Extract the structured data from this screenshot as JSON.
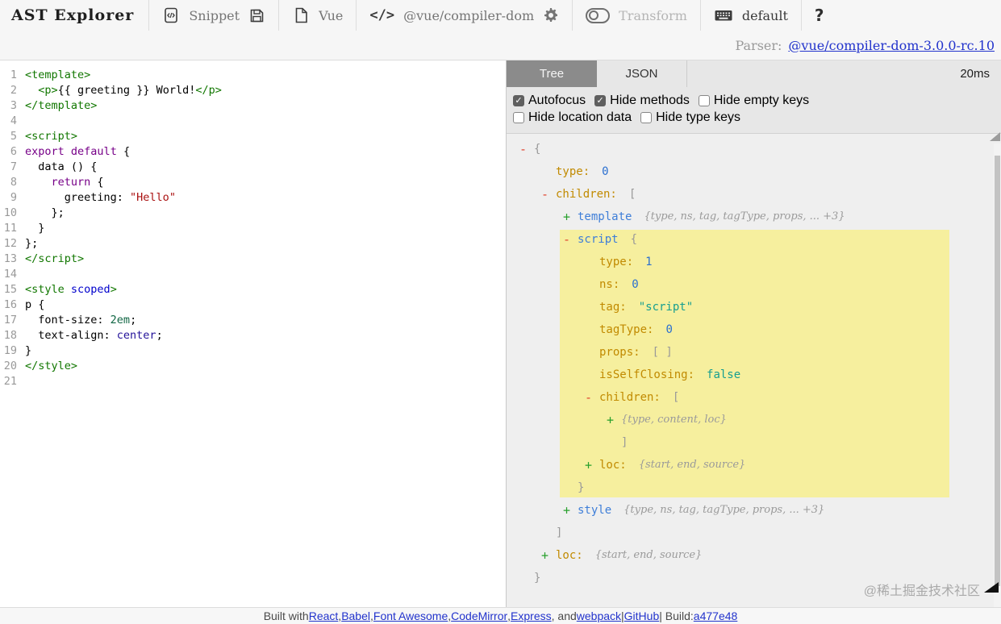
{
  "toolbar": {
    "title": "AST Explorer",
    "snippet_label": "Snippet",
    "language_label": "Vue",
    "code_icon_glyph": "</>",
    "parser_package": "@vue/compiler-dom",
    "transform_label": "Transform",
    "default_label": "default",
    "help_label": "?"
  },
  "parser_bar": {
    "label": "Parser:",
    "link": "@vue/compiler-dom-3.0.0-rc.10"
  },
  "tabs": {
    "tree": "Tree",
    "json": "JSON",
    "timing": "20ms"
  },
  "options_rows": [
    [
      {
        "label": "Autofocus",
        "checked": true
      },
      {
        "label": "Hide methods",
        "checked": true
      },
      {
        "label": "Hide empty keys",
        "checked": false
      }
    ],
    [
      {
        "label": "Hide location data",
        "checked": false
      },
      {
        "label": "Hide type keys",
        "checked": false
      }
    ]
  ],
  "editor": {
    "lines": [
      [
        [
          "<template>",
          "tag"
        ]
      ],
      [
        [
          "  ",
          "pl"
        ],
        [
          "<p>",
          "tag"
        ],
        [
          "{{ greeting }} World!",
          "pl"
        ],
        [
          "</p>",
          "tag"
        ]
      ],
      [
        [
          "</template>",
          "tag"
        ]
      ],
      [],
      [
        [
          "<script>",
          "tag"
        ]
      ],
      [
        [
          "export",
          "kw"
        ],
        [
          " ",
          "pl"
        ],
        [
          "default",
          "kw"
        ],
        [
          " {",
          "pl"
        ]
      ],
      [
        [
          "  data () {",
          "pl"
        ]
      ],
      [
        [
          "    ",
          "pl"
        ],
        [
          "return",
          "kw"
        ],
        [
          " {",
          "pl"
        ]
      ],
      [
        [
          "      greeting: ",
          "pl"
        ],
        [
          "\"Hello\"",
          "str"
        ]
      ],
      [
        [
          "    };",
          "pl"
        ]
      ],
      [
        [
          "  }",
          "pl"
        ]
      ],
      [
        [
          "};",
          "pl"
        ]
      ],
      [
        [
          "</script>",
          "tag"
        ]
      ],
      [],
      [
        [
          "<style ",
          "tag"
        ],
        [
          "scoped",
          "attr"
        ],
        [
          ">",
          "tag"
        ]
      ],
      [
        [
          "p {",
          "pl"
        ]
      ],
      [
        [
          "  font-size: ",
          "pl"
        ],
        [
          "2em",
          "cssnum"
        ],
        [
          ";",
          "pl"
        ]
      ],
      [
        [
          "  text-align: ",
          "pl"
        ],
        [
          "center",
          "csskw"
        ],
        [
          ";",
          "pl"
        ]
      ],
      [
        [
          "}",
          "pl"
        ]
      ],
      [
        [
          "</style>",
          "tag"
        ]
      ],
      []
    ]
  },
  "tree": {
    "rows": [
      {
        "i": 0,
        "t": "-",
        "hl": false,
        "s": [
          [
            "{",
            "pc"
          ]
        ]
      },
      {
        "i": 1,
        "t": "",
        "hl": false,
        "s": [
          [
            "type:",
            "k"
          ],
          [
            "0",
            "n"
          ]
        ]
      },
      {
        "i": 1,
        "t": "-",
        "hl": false,
        "s": [
          [
            "children:",
            "k"
          ],
          [
            "[",
            "pc"
          ]
        ]
      },
      {
        "i": 2,
        "t": "+",
        "hl": false,
        "s": [
          [
            "template",
            "nd"
          ],
          [
            "{type, ns, tag, tagType, props, ... +3}",
            "pv"
          ]
        ]
      },
      {
        "i": 2,
        "t": "-",
        "hl": true,
        "s": [
          [
            "script",
            "nd"
          ],
          [
            "{",
            "pc"
          ]
        ]
      },
      {
        "i": 3,
        "t": "",
        "hl": true,
        "s": [
          [
            "type:",
            "k"
          ],
          [
            "1",
            "n"
          ]
        ]
      },
      {
        "i": 3,
        "t": "",
        "hl": true,
        "s": [
          [
            "ns:",
            "k"
          ],
          [
            "0",
            "n"
          ]
        ]
      },
      {
        "i": 3,
        "t": "",
        "hl": true,
        "s": [
          [
            "tag:",
            "k"
          ],
          [
            "\"script\"",
            "s"
          ]
        ]
      },
      {
        "i": 3,
        "t": "",
        "hl": true,
        "s": [
          [
            "tagType:",
            "k"
          ],
          [
            "0",
            "n"
          ]
        ]
      },
      {
        "i": 3,
        "t": "",
        "hl": true,
        "s": [
          [
            "props:",
            "k"
          ],
          [
            "[ ]",
            "pc"
          ]
        ]
      },
      {
        "i": 3,
        "t": "",
        "hl": true,
        "s": [
          [
            "isSelfClosing:",
            "k"
          ],
          [
            "false",
            "b"
          ]
        ]
      },
      {
        "i": 3,
        "t": "-",
        "hl": true,
        "s": [
          [
            "children:",
            "k"
          ],
          [
            "[",
            "pc"
          ]
        ]
      },
      {
        "i": 4,
        "t": "+",
        "hl": true,
        "s": [
          [
            "{type, content, loc}",
            "pv"
          ]
        ]
      },
      {
        "i": 4,
        "t": "",
        "hl": true,
        "s": [
          [
            "]",
            "pc"
          ]
        ]
      },
      {
        "i": 3,
        "t": "+",
        "hl": true,
        "s": [
          [
            "loc:",
            "k"
          ],
          [
            "{start, end, source}",
            "pv"
          ]
        ]
      },
      {
        "i": 2,
        "t": "",
        "hl": true,
        "s": [
          [
            "}",
            "pc"
          ]
        ]
      },
      {
        "i": 2,
        "t": "+",
        "hl": false,
        "s": [
          [
            "style",
            "nd"
          ],
          [
            "{type, ns, tag, tagType, props, ... +3}",
            "pv"
          ]
        ]
      },
      {
        "i": 1,
        "t": "",
        "hl": false,
        "s": [
          [
            "]",
            "pc"
          ]
        ]
      },
      {
        "i": 1,
        "t": "+",
        "hl": false,
        "s": [
          [
            "loc:",
            "k"
          ],
          [
            "{start, end, source}",
            "pv"
          ]
        ]
      },
      {
        "i": 0,
        "t": "",
        "hl": false,
        "s": [
          [
            "}",
            "pc"
          ]
        ]
      }
    ]
  },
  "footer": {
    "segments": [
      {
        "text": "Built with ",
        "link": false
      },
      {
        "text": "React",
        "link": true
      },
      {
        "text": ", ",
        "link": false
      },
      {
        "text": "Babel",
        "link": true
      },
      {
        "text": ", ",
        "link": false
      },
      {
        "text": "Font Awesome",
        "link": true
      },
      {
        "text": ", ",
        "link": false
      },
      {
        "text": "CodeMirror",
        "link": true
      },
      {
        "text": ", ",
        "link": false
      },
      {
        "text": "Express",
        "link": true
      },
      {
        "text": ", and ",
        "link": false
      },
      {
        "text": "webpack",
        "link": true
      },
      {
        "text": " | ",
        "link": false
      },
      {
        "text": "GitHub",
        "link": true
      },
      {
        "text": " | Build: ",
        "link": false
      },
      {
        "text": "a477e48",
        "link": true
      }
    ]
  },
  "watermark": "@稀土掘金技术社区",
  "colors": {
    "highlight": "#f6ef9e",
    "accent_link": "#2233cc",
    "tab_active": "#8b8b8b"
  }
}
